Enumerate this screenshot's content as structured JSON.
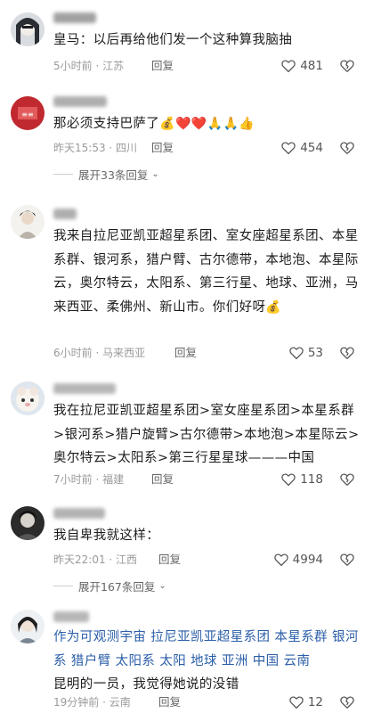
{
  "comments": [
    {
      "prefix": "皇马：",
      "text": "以后再给他们发一个这种算我脑抽",
      "time": "5小时前 · 江苏",
      "reply": "回复",
      "likes": "481"
    },
    {
      "text": "那必须支持巴萨了",
      "emoji": "💰❤️❤️🙏🙏👍",
      "time": "昨天15:53 · 四川",
      "reply": "回复",
      "likes": "454",
      "expand": "展开33条回复"
    },
    {
      "text": "我来自拉尼亚凯亚超星系团、室女座超星系团、本星系群、银河系，猎户臂、古尔德带，本地泡、本星际云，奥尔特云，太阳系、第三行星、地球、亚洲，马来西亚、柔佛州、新山市。你们好呀",
      "emoji": "💰",
      "time": "6小时前 · 马来西亚",
      "reply": "回复",
      "likes": "53"
    },
    {
      "text": "我在拉尼亚凯亚超星系团>室女座星系团>本星系群>银河系>猎户旋臂>古尔德带>本地泡>本星际云>奥尔特云>太阳系>第三行星星球———中国",
      "time": "7小时前 · 福建",
      "reply": "回复",
      "likes": "118"
    },
    {
      "text": "我自卑我就这样：",
      "time": "昨天22:01 · 江西",
      "reply": "回复",
      "likes": "4994",
      "expand": "展开167条回复"
    },
    {
      "text": "作为可观测宇宙 拉尼亚凯亚超星系团 本星系群 银河系 猎户臂 太阳系 太阳 地球 亚洲 中国 云南",
      "text2": "昆明的一员，我觉得她说的没错",
      "time": "19分钟前 · 云南",
      "reply": "回复",
      "likes": "12"
    }
  ]
}
